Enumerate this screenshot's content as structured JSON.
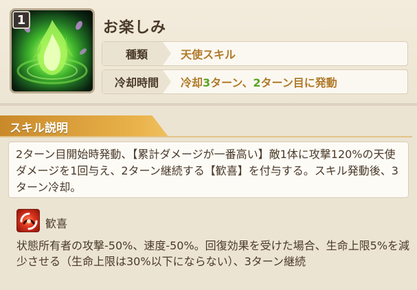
{
  "skill": {
    "level": "1",
    "icon": "green-flame-icon",
    "name": "お楽しみ",
    "type_label": "種類",
    "type_value": "天使スキル",
    "cooldown_label": "冷却時間",
    "cooldown_parts": [
      "冷却",
      "3",
      "ターン、",
      "2",
      "ターン目に発動"
    ]
  },
  "description": {
    "section_title": "スキル説明",
    "text": "2ターン目開始時発動、【累計ダメージが一番高い】敵1体に攻撃120%の天使ダメージを1回与え、2ターン継続する【歓喜】を付与する。スキル発動後、3ターン冷却。"
  },
  "status_effect": {
    "icon": "joy-status-icon",
    "name": "歓喜",
    "text": "状態所有者の攻撃-50%、速度-50%。回復効果を受けた場合、生命上限5%を減少させる（生命上限は30%以下にならない）、3ターン継続"
  },
  "colors": {
    "accent_gold": "#b07a2a",
    "accent_green": "#5aa321",
    "tab_orange": "#e9b24a"
  }
}
